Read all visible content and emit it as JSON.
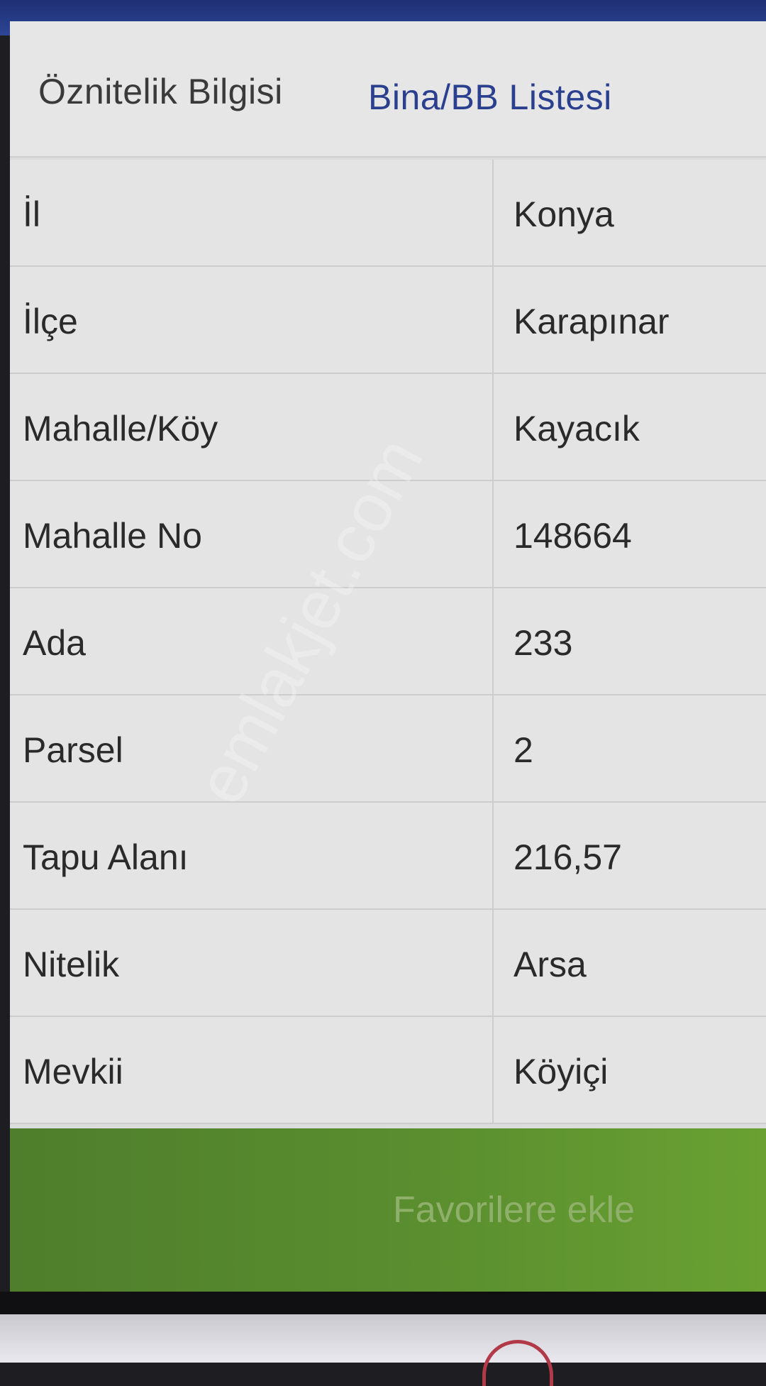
{
  "tabs": [
    {
      "label": "Öznitelik Bilgisi"
    },
    {
      "label": "Bina/BB Listesi"
    }
  ],
  "rows": [
    {
      "label": "İl",
      "value": "Konya"
    },
    {
      "label": "İlçe",
      "value": "Karapınar"
    },
    {
      "label": "Mahalle/Köy",
      "value": "Kayacık"
    },
    {
      "label": "Mahalle No",
      "value": "148664"
    },
    {
      "label": "Ada",
      "value": "233"
    },
    {
      "label": "Parsel",
      "value": "2"
    },
    {
      "label": "Tapu Alanı",
      "value": "216,57"
    },
    {
      "label": "Nitelik",
      "value": "Arsa"
    },
    {
      "label": "Mevkii",
      "value": "Köyiçi"
    }
  ],
  "action": {
    "label": "Favorilere ekle"
  },
  "watermark": "emlakjet.com",
  "colors": {
    "tab_active_text": "#2b3f8f",
    "action_bar": "#5a8e2f",
    "header_strip": "#2c4595"
  }
}
